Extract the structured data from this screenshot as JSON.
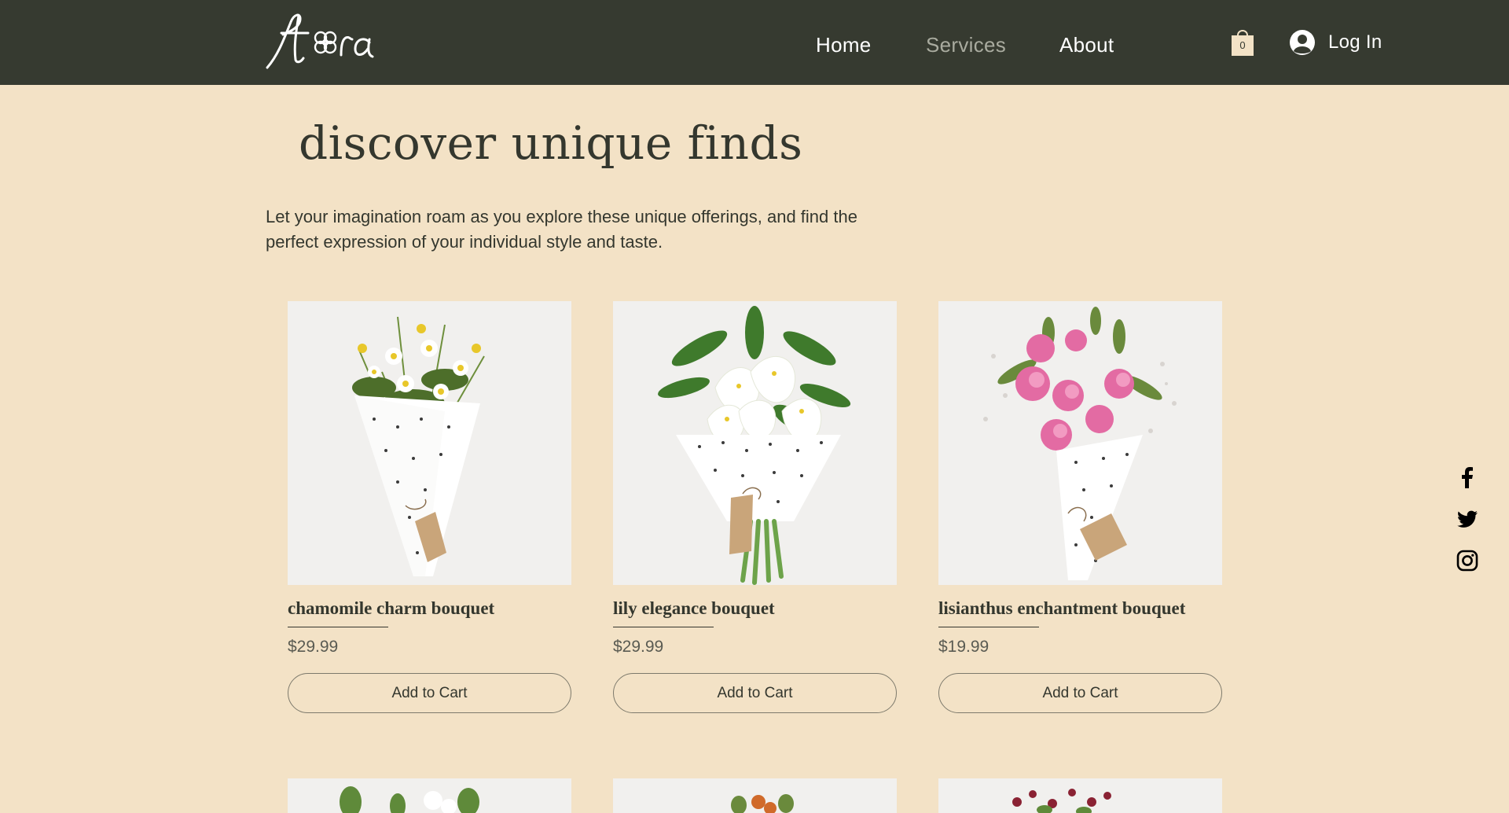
{
  "header": {
    "logo_text": "flora",
    "nav": [
      {
        "label": "Home",
        "active": false
      },
      {
        "label": "Services",
        "active": true
      },
      {
        "label": "About",
        "active": false
      }
    ],
    "cart_count": "0",
    "login_label": "Log In"
  },
  "main": {
    "title": "discover unique finds",
    "intro": "Let your imagination roam as you explore these unique offerings, and find the perfect expression of your individual style and taste.",
    "products": [
      {
        "name": "chamomile charm bouquet",
        "price": "$29.99",
        "button": "Add to Cart"
      },
      {
        "name": "lily elegance bouquet",
        "price": "$29.99",
        "button": "Add to Cart"
      },
      {
        "name": "lisianthus enchantment bouquet",
        "price": "$19.99",
        "button": "Add to Cart"
      }
    ]
  },
  "social": [
    "facebook-icon",
    "twitter-icon",
    "instagram-icon"
  ],
  "colors": {
    "header_bg": "#363a30",
    "page_bg": "#f3e2c6",
    "text": "#34372e",
    "nav_active": "#a9ab9f"
  }
}
